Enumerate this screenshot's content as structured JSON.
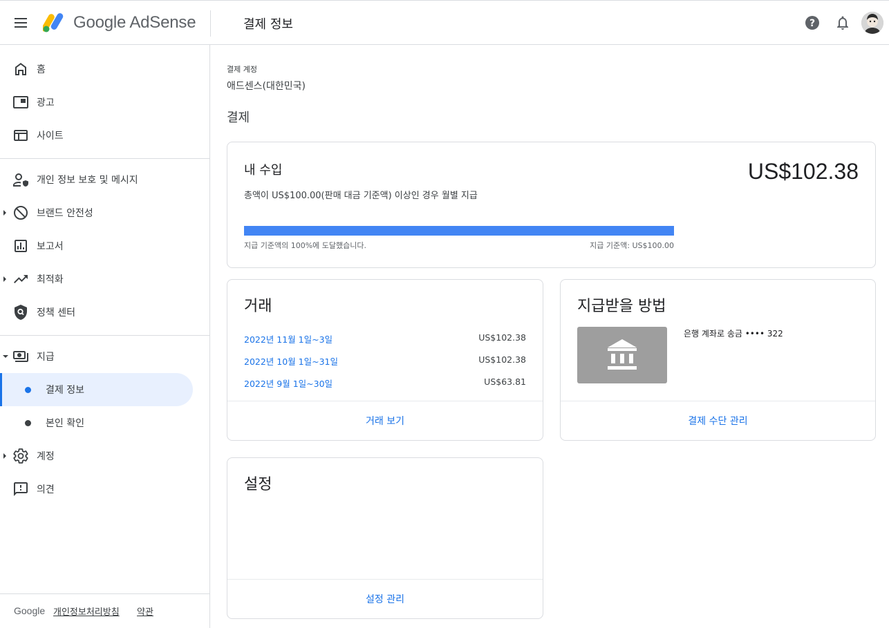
{
  "header": {
    "brand": "Google AdSense",
    "page_title": "결제 정보"
  },
  "sidebar": {
    "items": [
      {
        "label": "홈"
      },
      {
        "label": "광고"
      },
      {
        "label": "사이트"
      },
      {
        "label": "개인 정보 보호 및 메시지"
      },
      {
        "label": "브랜드 안전성"
      },
      {
        "label": "보고서"
      },
      {
        "label": "최적화"
      },
      {
        "label": "정책 센터"
      },
      {
        "label": "지급"
      },
      {
        "label": "계정"
      },
      {
        "label": "의견"
      }
    ],
    "sub_items": [
      {
        "label": "결제 정보",
        "active": true
      },
      {
        "label": "본인 확인",
        "active": false
      }
    ],
    "footer": {
      "google": "Google",
      "privacy": "개인정보처리방침",
      "terms": "약관"
    }
  },
  "main": {
    "account_label": "결제 계정",
    "account_name": "애드센스(대한민국)",
    "section_title": "결제",
    "earnings": {
      "title": "내 수입",
      "description": "총액이 US$100.00(판매 대금 기준액) 이상인 경우 월별 지급",
      "amount": "US$102.38",
      "progress_percent": 100,
      "progress_left": "지급 기준액의 100%에 도달했습니다.",
      "progress_right": "지급 기준액: US$100.00"
    },
    "transactions": {
      "title": "거래",
      "rows": [
        {
          "period": "2022년 11월 1일~3일",
          "amount": "US$102.38"
        },
        {
          "period": "2022년 10월 1일~31일",
          "amount": "US$102.38"
        },
        {
          "period": "2022년 9월 1일~30일",
          "amount": "US$63.81"
        }
      ],
      "action": "거래 보기"
    },
    "payment_method": {
      "title": "지급받을 방법",
      "bank_text": "은행 계좌로 송금 •••• 322",
      "action": "결제 수단 관리"
    },
    "settings": {
      "title": "설정",
      "action": "설정 관리"
    }
  },
  "colors": {
    "accent": "#1a73e8",
    "progress": "#4285f4",
    "active_bg": "#e8f0fe"
  }
}
